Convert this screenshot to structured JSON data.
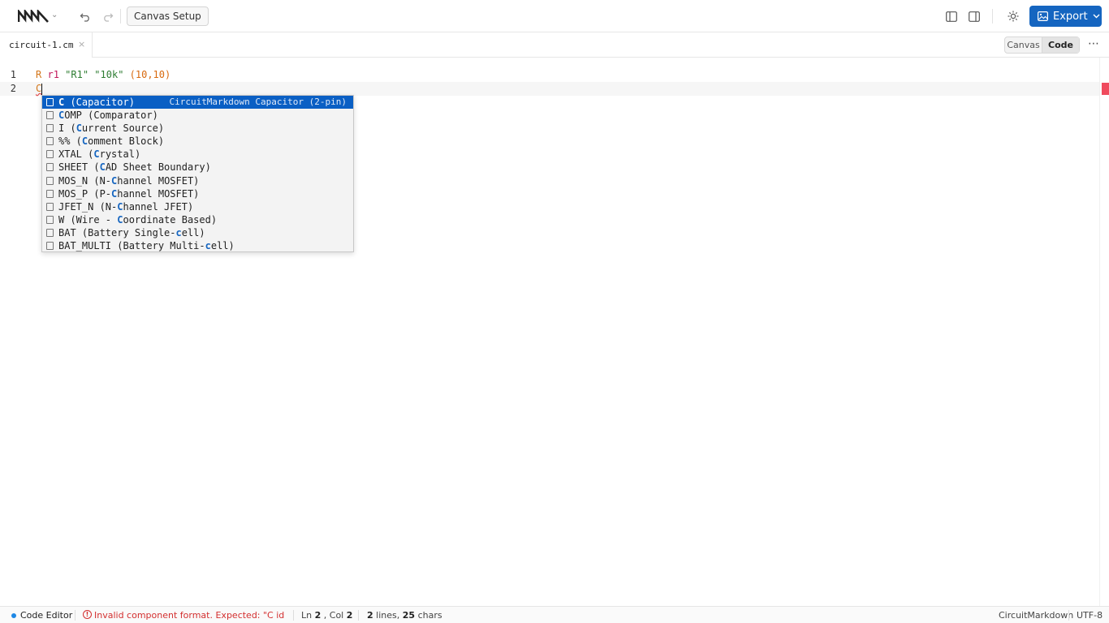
{
  "toolbar": {
    "canvas_setup_label": "Canvas Setup",
    "export_label": "Export",
    "accent_color": "#1565c0"
  },
  "tabs": {
    "file_name": "circuit-1.cm",
    "close_glyph": "×",
    "view_canvas": "Canvas",
    "view_code": "Code",
    "active_view": "Code",
    "more_glyph": "⋯"
  },
  "editor": {
    "lines": [
      {
        "number": "1",
        "kw": "R",
        "id": "r1",
        "label": "\"R1\"",
        "value": "\"10k\"",
        "coords": "(10,10)"
      },
      {
        "number": "2",
        "typed": "C"
      }
    ]
  },
  "suggestions": {
    "items": [
      {
        "pre": "",
        "match": "C",
        "post": " (Capacitor)",
        "detail": "CircuitMarkdown Capacitor (2-pin)"
      },
      {
        "pre": "",
        "match": "C",
        "post": "OMP (Comparator)"
      },
      {
        "pre": "I (",
        "match": "C",
        "post": "urrent Source)"
      },
      {
        "pre": "%% (",
        "match": "C",
        "post": "omment Block)"
      },
      {
        "pre": "XTAL (",
        "match": "C",
        "post": "rystal)"
      },
      {
        "pre": "SHEET (",
        "match": "C",
        "post": "AD Sheet Boundary)"
      },
      {
        "pre": "MOS_N (N-",
        "match": "C",
        "post": "hannel MOSFET)"
      },
      {
        "pre": "MOS_P (P-",
        "match": "C",
        "post": "hannel MOSFET)"
      },
      {
        "pre": "JFET_N (N-",
        "match": "C",
        "post": "hannel JFET)"
      },
      {
        "pre": "W (Wire - ",
        "match": "C",
        "post": "oordinate Based)"
      },
      {
        "pre": "BAT (Battery Single-",
        "match": "c",
        "post": "ell)"
      },
      {
        "pre": "BAT_MULTI (Battery Multi-",
        "match": "c",
        "post": "ell)"
      }
    ]
  },
  "status": {
    "mode": "Code Editor",
    "error": "Invalid component format. Expected: \"C id \\\"des...",
    "ln_label": "Ln",
    "ln": "2",
    "col_label": ", Col",
    "col": "2",
    "lines_count": "2",
    "lines_label": "lines,",
    "chars_count": "25",
    "chars_label": "chars",
    "language": "CircuitMarkdown",
    "encoding": "UTF-8"
  }
}
